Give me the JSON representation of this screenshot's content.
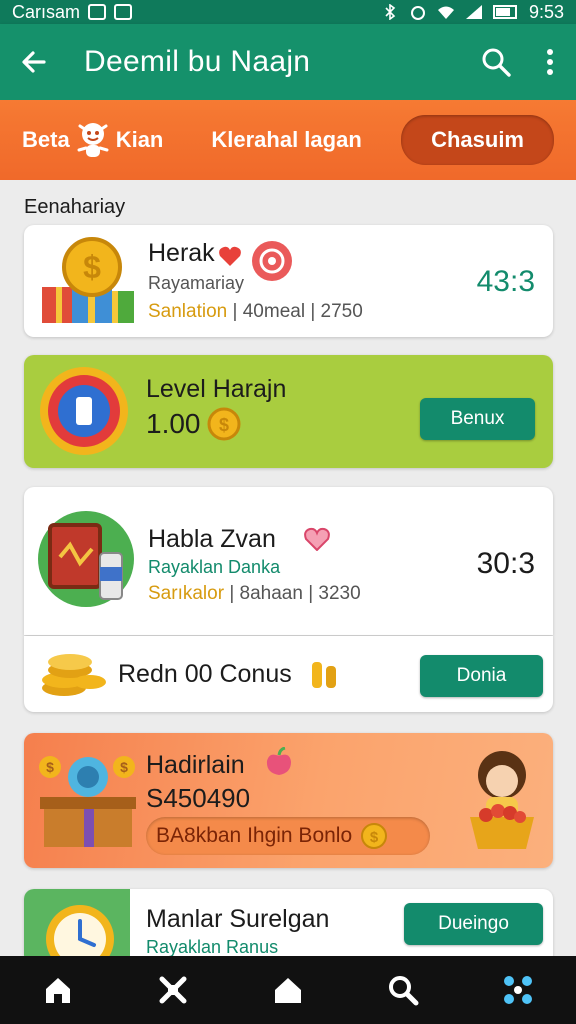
{
  "status_bar": {
    "carrier": "Carısam",
    "time": "9:53",
    "icons": [
      "notification-icon",
      "image-icon",
      "bluetooth-icon",
      "alarm-icon",
      "wifi-icon",
      "signal-icon",
      "battery-icon"
    ]
  },
  "app_bar": {
    "title": "Deemil bu Naajn",
    "back_icon": "arrow-left-icon",
    "search_icon": "search-icon",
    "menu_icon": "more-vertical-icon"
  },
  "tabs": [
    {
      "label_a": "Beta",
      "label_b": "Kian"
    },
    {
      "label": "Klerahal lagan"
    },
    {
      "label": "Chasuim",
      "active": true
    }
  ],
  "section_title": "Eenahariay",
  "cards": {
    "card1": {
      "name": "Herak",
      "subtitle": "Rayamariay",
      "meta_accent": "Sanlation",
      "meta_rest": "| 40meal | 2750",
      "score": "43:3",
      "score_color": "#138b6c"
    },
    "card2": {
      "name": "Level Harajn",
      "value": "1.00",
      "button": "Benux"
    },
    "card3": {
      "name": "Habla Zvan",
      "subtitle": "Rayaklan Danka",
      "meta_accent": "Sarıkalor",
      "meta_rest": "| 8ahaan | 3230",
      "score": "30:3"
    },
    "card4": {
      "label": "Redn 00 Conus",
      "button": "Donia"
    },
    "card5": {
      "name": "Hadirlain",
      "amount": "S450490",
      "pill": "BA8kban Ihgin Bonlo"
    },
    "card6": {
      "name": "Manlar Surelgan",
      "subtitle": "Rayaklan Ranus",
      "button": "Dueingo"
    }
  },
  "bottom_nav": [
    "home-icon",
    "tools-icon",
    "house-icon",
    "search-icon",
    "network-icon"
  ],
  "colors": {
    "primary": "#15916b",
    "orange": "#f36d2c",
    "lime": "#a9cd3f",
    "gold": "#f2b51c"
  }
}
